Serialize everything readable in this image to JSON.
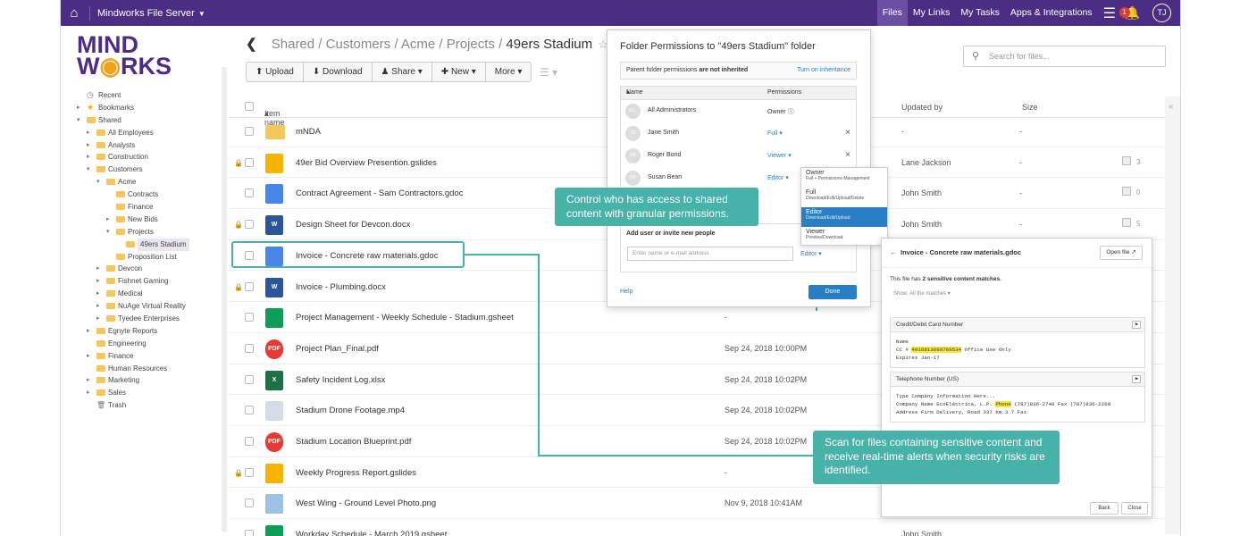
{
  "topbar": {
    "app_name": "Mindworks File Server",
    "nav": [
      "Files",
      "My Links",
      "My Tasks",
      "Apps & Integrations"
    ],
    "notification_count": "1",
    "user_initials": "TJ"
  },
  "logo": {
    "line1": "MIND",
    "line2": "W",
    "line2_rest": "RKS"
  },
  "sidebar": {
    "items": [
      {
        "label": "Recent",
        "depth": 0,
        "type": "recent"
      },
      {
        "label": "Bookmarks",
        "depth": 0,
        "type": "star",
        "tw": "▸"
      },
      {
        "label": "Shared",
        "depth": 0,
        "type": "folder",
        "tw": "▾"
      },
      {
        "label": "All Employees",
        "depth": 1,
        "type": "folder",
        "tw": "▸"
      },
      {
        "label": "Analysts",
        "depth": 1,
        "type": "folder",
        "tw": "▸"
      },
      {
        "label": "Construction",
        "depth": 1,
        "type": "folder",
        "tw": "▸"
      },
      {
        "label": "Customers",
        "depth": 1,
        "type": "folder",
        "tw": "▾"
      },
      {
        "label": "Acme",
        "depth": 2,
        "type": "folder",
        "tw": "▾"
      },
      {
        "label": "Contracts",
        "depth": 3,
        "type": "folder"
      },
      {
        "label": "Finance",
        "depth": 3,
        "type": "folder"
      },
      {
        "label": "New Bids",
        "depth": 3,
        "type": "folder",
        "tw": "▸"
      },
      {
        "label": "Projects",
        "depth": 3,
        "type": "folder",
        "tw": "▾"
      },
      {
        "label": "49ers Stadium",
        "depth": 4,
        "type": "folder",
        "selected": true
      },
      {
        "label": "Proposition List",
        "depth": 3,
        "type": "folder"
      },
      {
        "label": "Devcon",
        "depth": 2,
        "type": "folder",
        "tw": "▸"
      },
      {
        "label": "Fishnet Gaming",
        "depth": 2,
        "type": "folder",
        "tw": "▸"
      },
      {
        "label": "Medical",
        "depth": 2,
        "type": "folder",
        "tw": "▸"
      },
      {
        "label": "NuAge Virtual Reality",
        "depth": 2,
        "type": "folder",
        "tw": "▸"
      },
      {
        "label": "Tyedee Enterprises",
        "depth": 2,
        "type": "folder",
        "tw": "▸"
      },
      {
        "label": "Egnyte Reports",
        "depth": 1,
        "type": "folder",
        "tw": "▸"
      },
      {
        "label": "Engineering",
        "depth": 1,
        "type": "folder"
      },
      {
        "label": "Finance",
        "depth": 1,
        "type": "folder",
        "tw": "▸"
      },
      {
        "label": "Human Resources",
        "depth": 1,
        "type": "folder"
      },
      {
        "label": "Marketing",
        "depth": 1,
        "type": "folder",
        "tw": "▸"
      },
      {
        "label": "Sales",
        "depth": 1,
        "type": "folder",
        "tw": "▸"
      },
      {
        "label": "Trash",
        "depth": 1,
        "type": "trash"
      }
    ]
  },
  "breadcrumb": {
    "items": [
      "Shared",
      "Customers",
      "Acme",
      "Projects"
    ],
    "current": "49ers Stadium"
  },
  "toolbar": {
    "upload": "Upload",
    "download": "Download",
    "share": "Share",
    "new": "New",
    "more": "More"
  },
  "search": {
    "placeholder": "Search for files..."
  },
  "table": {
    "headers": {
      "name": "Item name",
      "updated_by": "Updated by",
      "size": "Size"
    },
    "rows": [
      {
        "name": "mNDA",
        "type": "folder",
        "updated": "",
        "by": "-",
        "size": "-"
      },
      {
        "name": "49er Bid Overview Presention.gslides",
        "type": "slides",
        "locked": true,
        "updated": "",
        "by": "Lane Jackson",
        "size": "-",
        "comments": "3"
      },
      {
        "name": "Contract Agreement - Sam Contractors.gdoc",
        "type": "doc",
        "updated": "",
        "by": "John Smith",
        "size": "-",
        "comments": "0"
      },
      {
        "name": "Design Sheet for Devcon.docx",
        "type": "word",
        "locked": true,
        "updated": "",
        "by": "John Smith",
        "size": "-",
        "comments": "5"
      },
      {
        "name": "Invoice - Concrete raw materials.gdoc",
        "type": "doc",
        "updated": "",
        "by": "",
        "size": ""
      },
      {
        "name": "Invoice - Plumbing.docx",
        "type": "word",
        "locked": true,
        "updated": "",
        "by": "",
        "size": ""
      },
      {
        "name": "Project Management - Weekly Schedule - Stadium.gsheet",
        "type": "sheet",
        "updated": "-",
        "by": "",
        "size": ""
      },
      {
        "name": "Project Plan_Final.pdf",
        "type": "pdf",
        "updated": "Sep 24, 2018 10:00PM",
        "by": "",
        "size": ""
      },
      {
        "name": "Safety Incident Log.xlsx",
        "type": "xls",
        "updated": "Sep 24, 2018 10:02PM",
        "by": "",
        "size": ""
      },
      {
        "name": "Stadium Drone Footage.mp4",
        "type": "video",
        "updated": "Sep 24, 2018 10:02PM",
        "by": "",
        "size": ""
      },
      {
        "name": "Stadium Location Blueprint.pdf",
        "type": "pdf",
        "updated": "Sep 24, 2018 10:02PM",
        "by": "",
        "size": ""
      },
      {
        "name": "Weekly Progress Report.gslides",
        "type": "slides",
        "locked": true,
        "updated": "-",
        "by": "",
        "size": ""
      },
      {
        "name": "West Wing - Ground Level Photo.png",
        "type": "png",
        "updated": "Nov 9, 2018 10:41AM",
        "by": "",
        "size": ""
      },
      {
        "name": "Workday Schedule - March 2019.gsheet",
        "type": "sheet",
        "updated": "",
        "by": "John Smith",
        "size": ""
      }
    ]
  },
  "callouts": {
    "permissions": "Control who has access to shared content with granular permissions.",
    "scan": "Scan for files containing sensitive content and receive real-time alerts when security risks are identified."
  },
  "permissions_dialog": {
    "title": "Folder Permissions to \"49ers Stadium\" folder",
    "inherit_prefix": "Parent folder permissions ",
    "inherit_bold": "are not inherited",
    "inherit_toggle": "Turn on inheritance",
    "col_name": "Name",
    "col_perm": "Permissions",
    "users": [
      {
        "initials": "ALL",
        "name": "All Administrators",
        "role": "Owner",
        "removable": false
      },
      {
        "initials": "JS",
        "name": "Jane Smith",
        "role": "Full",
        "removable": true
      },
      {
        "initials": "RB",
        "name": "Roger Bond",
        "role": "Viewer",
        "removable": true
      },
      {
        "initials": "SB",
        "name": "Susan Bean",
        "role": "Editor",
        "removable": false
      }
    ],
    "add_label": "Add user or invite new people",
    "add_placeholder": "Enter name or e-mail address",
    "add_role": "Editor",
    "help": "Help",
    "done": "Done"
  },
  "role_dropdown": [
    {
      "name": "Owner",
      "desc": "Full + Permissions Management"
    },
    {
      "name": "Full",
      "desc": "Download/Edit/Upload/Delete"
    },
    {
      "name": "Editor",
      "desc": "Download/Edit/Upload",
      "selected": true
    },
    {
      "name": "Viewer",
      "desc": "Preview/Download"
    }
  ],
  "sensitive_panel": {
    "file_name": "Invoice - Concrete raw materials.gdoc",
    "open_file": "Open file",
    "msg_prefix": "This file has ",
    "msg_bold": "2 sensitive content matches",
    "show": "Show: All the matches",
    "cards": [
      {
        "title": "Credit/Debit Card Number",
        "line1": "Name",
        "pre": "CC # ",
        "mark": "4916813680769534",
        "post": " Office Use Only",
        "line3": "Expires Jan-17"
      },
      {
        "title": "Telephone Number (US)",
        "line1": "Type Company Information Here...",
        "pre": "Company Name EcoEléctrica, L.P. ",
        "mark": "Phone",
        "post": " (787)836-2740 Fax (787)836-2260",
        "line3": "Address Firm Delivery, Road 337 Km.3.7 Fax"
      }
    ],
    "back": "Back",
    "close": "Close"
  }
}
